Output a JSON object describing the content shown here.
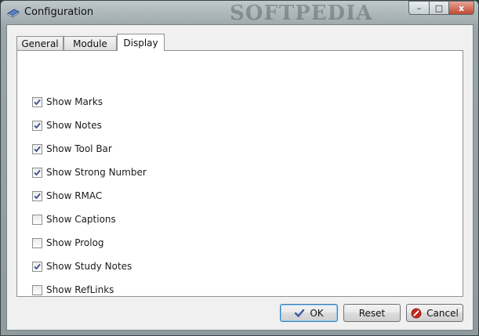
{
  "window": {
    "title": "Configuration",
    "watermark": "SOFTPEDIA",
    "controls": {
      "minimize": "–",
      "maximize": "□",
      "close": "x"
    }
  },
  "tabs": [
    {
      "label": "General",
      "active": false
    },
    {
      "label": "Module",
      "active": false
    },
    {
      "label": "Display",
      "active": true
    }
  ],
  "options": [
    {
      "label": "Show Marks",
      "checked": true
    },
    {
      "label": "Show Notes",
      "checked": true
    },
    {
      "label": "Show Tool Bar",
      "checked": true
    },
    {
      "label": "Show Strong Number",
      "checked": true
    },
    {
      "label": "Show RMAC",
      "checked": true
    },
    {
      "label": "Show Captions",
      "checked": false
    },
    {
      "label": "Show Prolog",
      "checked": false
    },
    {
      "label": "Show Study Notes",
      "checked": true
    },
    {
      "label": "Show RefLinks",
      "checked": false
    }
  ],
  "buttons": {
    "ok": "OK",
    "reset": "Reset",
    "cancel": "Cancel"
  },
  "icons": {
    "app": "book-icon",
    "ok": "checkmark-icon",
    "cancel": "no-entry-icon"
  },
  "colors": {
    "check": "#3a4f8c",
    "ok_icon": "#3b5aa8",
    "cancel_icon": "#c8261a"
  }
}
